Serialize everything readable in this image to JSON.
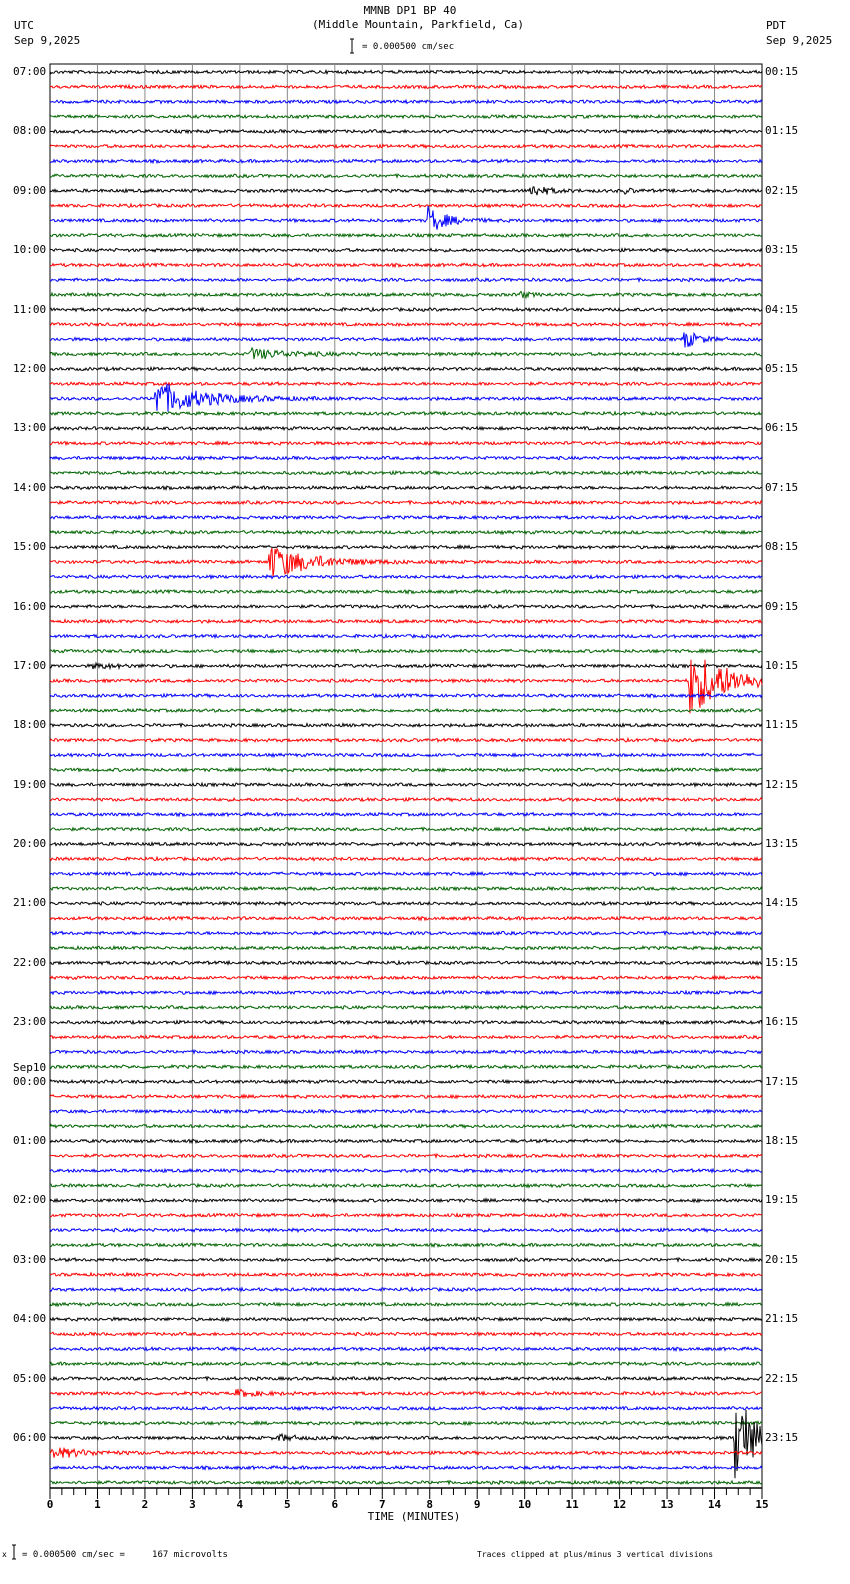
{
  "header": {
    "title": "MMNB DP1 BP 40",
    "subtitle": "(Middle Mountain, Parkfield, Ca)",
    "left_tz": "UTC",
    "left_date": "Sep 9,2025",
    "right_tz": "PDT",
    "right_date": "Sep 9,2025",
    "scale": "= 0.000500 cm/sec"
  },
  "footer": {
    "scale_prefix": "x",
    "scale": "= 0.000500 cm/sec =     167 microvolts",
    "clip_note": "Traces clipped at plus/minus 3 vertical divisions"
  },
  "chart_data": {
    "type": "line",
    "title": "MMNB DP1 BP 40",
    "xlabel": "TIME (MINUTES)",
    "xlim": [
      0,
      15
    ],
    "x_ticks": [
      "0",
      "1",
      "2",
      "3",
      "4",
      "5",
      "6",
      "7",
      "8",
      "9",
      "10",
      "11",
      "12",
      "13",
      "14",
      "15"
    ],
    "trace_colors": [
      "#000000",
      "#ff0000",
      "#0000ff",
      "#006400"
    ],
    "traces_per_hour": 4,
    "day_change_label": "Sep10",
    "left_labels": [
      "07:00",
      "08:00",
      "09:00",
      "10:00",
      "11:00",
      "12:00",
      "13:00",
      "14:00",
      "15:00",
      "16:00",
      "17:00",
      "18:00",
      "19:00",
      "20:00",
      "21:00",
      "22:00",
      "23:00",
      "00:00",
      "01:00",
      "02:00",
      "03:00",
      "04:00",
      "05:00",
      "06:00"
    ],
    "right_labels": [
      "00:15",
      "01:15",
      "02:15",
      "03:15",
      "04:15",
      "05:15",
      "06:15",
      "07:15",
      "08:15",
      "09:15",
      "10:15",
      "11:15",
      "12:15",
      "13:15",
      "14:15",
      "15:15",
      "16:15",
      "17:15",
      "18:15",
      "19:15",
      "20:15",
      "21:15",
      "22:15",
      "23:15"
    ],
    "events": [
      {
        "trace": 8,
        "minute": 10.1,
        "amp": 1.2,
        "dur": 0.6
      },
      {
        "trace": 8,
        "minute": 12.1,
        "amp": 0.5,
        "dur": 0.3
      },
      {
        "trace": 10,
        "minute": 7.95,
        "amp": 2.4,
        "dur": 0.7
      },
      {
        "trace": 15,
        "minute": 9.9,
        "amp": 0.5,
        "dur": 0.4
      },
      {
        "trace": 18,
        "minute": 13.35,
        "amp": 1.8,
        "dur": 0.5
      },
      {
        "trace": 19,
        "minute": 4.2,
        "amp": 0.9,
        "dur": 1.5
      },
      {
        "trace": 22,
        "minute": 2.2,
        "amp": 3,
        "dur": 1.8
      },
      {
        "trace": 33,
        "minute": 4.6,
        "amp": 3,
        "dur": 1.6
      },
      {
        "trace": 41,
        "minute": 13.45,
        "amp": 6,
        "dur": 1.5
      },
      {
        "trace": 40,
        "minute": 0.9,
        "amp": 0.4,
        "dur": 1.0
      },
      {
        "trace": 89,
        "minute": 3.9,
        "amp": 0.6,
        "dur": 0.8
      },
      {
        "trace": 92,
        "minute": 4.8,
        "amp": 0.6,
        "dur": 0.6
      },
      {
        "trace": 92,
        "minute": 14.4,
        "amp": 12,
        "dur": 0.6
      },
      {
        "trace": 93,
        "minute": 0.0,
        "amp": 1.0,
        "dur": 1.2
      }
    ]
  }
}
